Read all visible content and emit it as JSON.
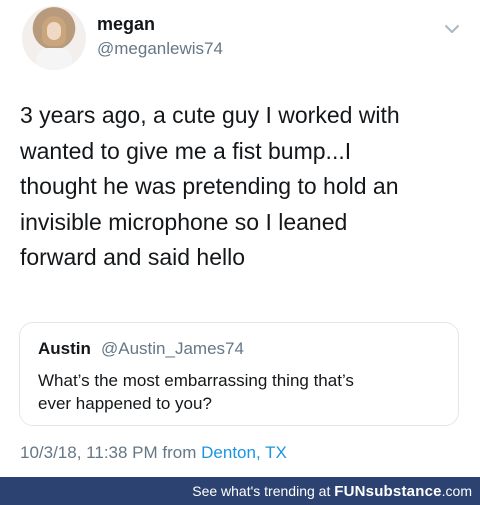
{
  "user": {
    "name": "megan",
    "handle": "@meganlewis74",
    "icon": "avatar-photo"
  },
  "tweet": {
    "lines": [
      "3 years ago, a cute guy I worked with",
      "wanted to give me a fist bump...I",
      "thought he was pretending to hold an",
      "invisible microphone so I leaned",
      "forward and said hello"
    ]
  },
  "quote": {
    "name": "Austin",
    "handle": "@Austin_James74",
    "lines": [
      "What’s the most embarrassing thing that’s",
      "ever happened to you?"
    ]
  },
  "meta": {
    "timestamp": "10/3/18, 11:38 PM",
    "from_word": "from",
    "location": "Denton, TX"
  },
  "footer": {
    "prefix": "See what's trending at",
    "brand_a": "FUN",
    "brand_b": "substance",
    "brand_c": ".com"
  },
  "icons": {
    "more": "chevron-down-icon"
  },
  "colors": {
    "link": "#1b95e0",
    "secondary": "#657786",
    "footer_bg": "#2c4270"
  }
}
